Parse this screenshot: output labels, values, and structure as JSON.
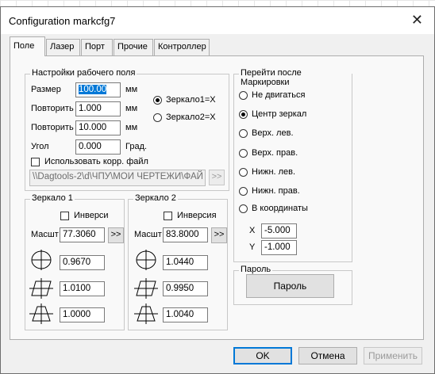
{
  "window": {
    "title": "Configuration markcfg7",
    "close_glyph": "✕"
  },
  "tabs": [
    "Поле",
    "Лазер",
    "Порт",
    "Прочие",
    "Контроллер"
  ],
  "field_settings": {
    "legend": "Настройки рабочего поля",
    "size_label": "Размер",
    "size_value": "100.00",
    "size_unit": "мм",
    "repeat1_label": "Повторить",
    "repeat1_value": "1.000",
    "repeat1_unit": "мм",
    "repeat2_label": "Повторить",
    "repeat2_value": "10.000",
    "repeat2_unit": "мм",
    "angle_label": "Угол",
    "angle_value": "0.000",
    "angle_unit": "Град.",
    "mirror_option1": "Зеркало1=X",
    "mirror_option1_checked": true,
    "mirror_option2": "Зеркало2=X",
    "use_corr_label": "Использовать корр. файл",
    "use_corr_checked": false,
    "corr_path": "\\\\Dagtools-2\\d\\ЧПУ\\МОИ ЧЕРТЕЖИ\\ФАЙ",
    "browse_label": ">>"
  },
  "mirror1": {
    "legend": "Зеркало 1",
    "invert_label": "Инверси",
    "invert_checked": false,
    "scale_label": "Масшт",
    "scale_value": "77.3060",
    "scale_btn": ">>",
    "param1": "0.9670",
    "param2": "1.0100",
    "param3": "1.0000"
  },
  "mirror2": {
    "legend": "Зеркало 2",
    "invert_label": "Инверсия",
    "invert_checked": false,
    "scale_label": "Масшт",
    "scale_value": "83.8000",
    "scale_btn": ">>",
    "param1": "1.0440",
    "param2": "0.9950",
    "param3": "1.0040"
  },
  "after_mark": {
    "legend": "Перейти после Маркировки",
    "options": [
      "Не двигаться",
      "Центр зеркал",
      "Верх. лев.",
      "Верх. прав.",
      "Нижн. лев.",
      "Нижн. прав.",
      "В координаты"
    ],
    "selected_index": 1,
    "x_label": "X",
    "x_value": "-5.000",
    "y_label": "Y",
    "y_value": "-1.000"
  },
  "password": {
    "legend": "Пароль",
    "button": "Пароль"
  },
  "footer": {
    "ok": "OK",
    "cancel": "Отмена",
    "apply": "Применить"
  }
}
